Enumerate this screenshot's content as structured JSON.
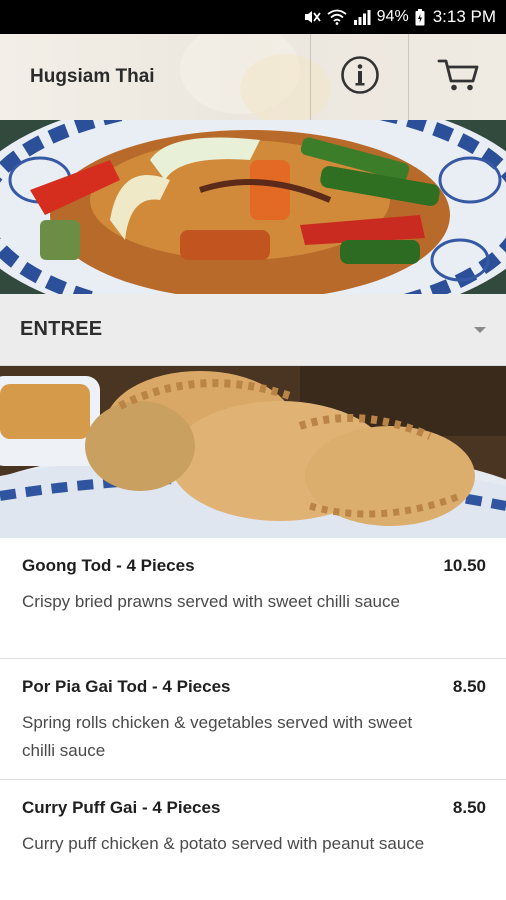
{
  "status_bar": {
    "battery": "94%",
    "time": "3:13 PM",
    "icons": [
      "mute-icon",
      "wifi-icon",
      "signal-icon",
      "battery-icon"
    ]
  },
  "header": {
    "title": "Hugsiam Thai",
    "info_icon": "info-icon",
    "cart_icon": "cart-icon"
  },
  "category": {
    "label": "ENTREE",
    "icon": "dropdown-caret-icon"
  },
  "menu_items": [
    {
      "name": "Goong Tod - 4 Pieces",
      "price": "10.50",
      "description": "Crispy bried prawns served with sweet chilli sauce"
    },
    {
      "name": "Por Pia Gai Tod - 4 Pieces",
      "price": "8.50",
      "description": "Spring rolls chicken & vegetables served with sweet chilli sauce"
    },
    {
      "name": "Curry Puff Gai - 4 Pieces",
      "price": "8.50",
      "description": "Curry puff chicken & potato served with peanut sauce"
    }
  ],
  "colors": {
    "status_bar_bg": "#000000",
    "category_bg": "#ececec",
    "text_dark": "#1f1f1f",
    "text_muted": "#4a4a4a"
  }
}
